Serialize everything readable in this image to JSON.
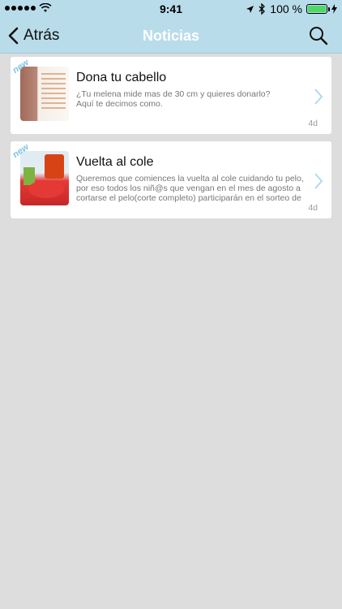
{
  "status": {
    "time": "9:41",
    "battery_pct": "100 %",
    "battery_level": 1.0
  },
  "nav": {
    "back_label": "Atrás",
    "title": "Noticias"
  },
  "news": [
    {
      "badge": "new",
      "title": "Dona tu cabello",
      "desc_line1": "¿Tu melena mide mas de 30 cm y quieres donarlo?",
      "desc_line2": "Aquí te decimos como.",
      "age": "4d"
    },
    {
      "badge": "new",
      "title": "Vuelta al cole",
      "description": "Queremos que comiences la vuelta al cole cuidando tu pelo, por eso todos los niñ@s que vengan en el mes de agosto a cortarse el pelo(corte completo) participarán en el sorteo de un lote de p...",
      "age": "4d"
    }
  ],
  "colors": {
    "bar": "#b8dcea",
    "accent": "#7ec4ea",
    "background": "#dddddd"
  }
}
